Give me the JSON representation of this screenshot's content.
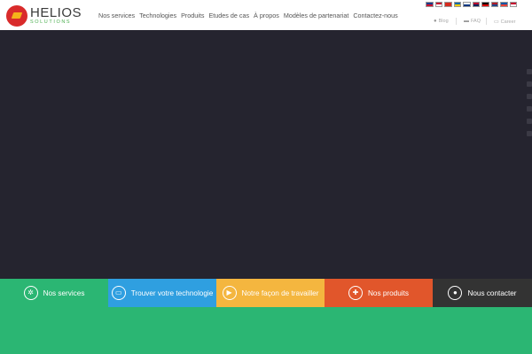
{
  "logo": {
    "name": "HELIOS",
    "sub": "SOLUTIONS"
  },
  "nav": [
    "Nos services",
    "Technologies",
    "Produits",
    "Etudes de cas",
    "À propos",
    "Modèles de partenariat",
    "Contactez-nous"
  ],
  "languages": [
    {
      "code": "en",
      "colors": [
        "#1a3b8c",
        "#c8102e"
      ]
    },
    {
      "code": "at",
      "colors": [
        "#c8102e",
        "#ffffff"
      ]
    },
    {
      "code": "ch",
      "colors": [
        "#d52b1e",
        "#d52b1e"
      ]
    },
    {
      "code": "se",
      "colors": [
        "#006aa7",
        "#fecc00"
      ]
    },
    {
      "code": "fi",
      "colors": [
        "#ffffff",
        "#003580"
      ]
    },
    {
      "code": "no",
      "colors": [
        "#ba0c2f",
        "#00205b"
      ]
    },
    {
      "code": "de",
      "colors": [
        "#000000",
        "#dd0000"
      ]
    },
    {
      "code": "nl",
      "colors": [
        "#ae1c28",
        "#21468b"
      ]
    },
    {
      "code": "fr",
      "colors": [
        "#0055a4",
        "#ef4135"
      ]
    },
    {
      "code": "dk",
      "colors": [
        "#c60c30",
        "#ffffff"
      ]
    }
  ],
  "utility": {
    "blog": "Blog",
    "faq": "FAQ",
    "career": "Career"
  },
  "tabs": [
    {
      "label": "Nos services",
      "icon": "gear-icon",
      "glyph": "✲",
      "color": "#2bb673"
    },
    {
      "label": "Trouver votre technologie",
      "icon": "monitor-icon",
      "glyph": "▭",
      "color": "#2f9fe0"
    },
    {
      "label": "Notre façon de travailler",
      "icon": "play-icon",
      "glyph": "▶",
      "color": "#f4b63f"
    },
    {
      "label": "Nos produits",
      "icon": "gift-icon",
      "glyph": "✚",
      "color": "#e1562b"
    },
    {
      "label": "Nous contacter",
      "icon": "user-icon",
      "glyph": "●",
      "color": "#333333"
    }
  ],
  "colors": {
    "hero": "#25242f",
    "bottom": "#2bb673"
  }
}
